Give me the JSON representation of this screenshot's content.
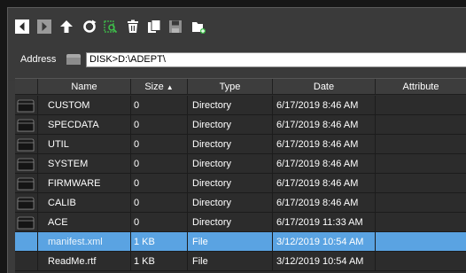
{
  "toolbar": {
    "buttons": [
      {
        "name": "back-icon"
      },
      {
        "name": "forward-icon"
      },
      {
        "name": "up-icon"
      },
      {
        "name": "refresh-icon"
      },
      {
        "name": "search-icon"
      },
      {
        "name": "delete-icon"
      },
      {
        "name": "copy-icon"
      },
      {
        "name": "save-icon"
      },
      {
        "name": "new-folder-icon"
      }
    ]
  },
  "address": {
    "label": "Address",
    "value": "DISK>D:\\ADEPT\\"
  },
  "table": {
    "columns": {
      "name": "Name",
      "size": "Size",
      "size_sort": "▲",
      "type": "Type",
      "date": "Date",
      "attribute": "Attribute"
    },
    "rows": [
      {
        "name": "CUSTOM",
        "size": "0",
        "type": "Directory",
        "date": "6/17/2019 8:46 AM",
        "attribute": ""
      },
      {
        "name": "SPECDATA",
        "size": "0",
        "type": "Directory",
        "date": "6/17/2019 8:46 AM",
        "attribute": ""
      },
      {
        "name": "UTIL",
        "size": "0",
        "type": "Directory",
        "date": "6/17/2019 8:46 AM",
        "attribute": ""
      },
      {
        "name": "SYSTEM",
        "size": "0",
        "type": "Directory",
        "date": "6/17/2019 8:46 AM",
        "attribute": ""
      },
      {
        "name": "FIRMWARE",
        "size": "0",
        "type": "Directory",
        "date": "6/17/2019 8:46 AM",
        "attribute": ""
      },
      {
        "name": "CALIB",
        "size": "0",
        "type": "Directory",
        "date": "6/17/2019 8:46 AM",
        "attribute": ""
      },
      {
        "name": "ACE",
        "size": "0",
        "type": "Directory",
        "date": "6/17/2019 11:33 AM",
        "attribute": ""
      },
      {
        "name": "manifest.xml",
        "size": "1 KB",
        "type": "File",
        "date": "3/12/2019 10:54 AM",
        "attribute": ""
      },
      {
        "name": "ReadMe.rtf",
        "size": "1 KB",
        "type": "File",
        "date": "3/12/2019 10:54 AM",
        "attribute": ""
      }
    ],
    "selected_row": "manifest.xml"
  },
  "colors": {
    "background": "#3b3b3b",
    "selection": "#5aa3e2",
    "accent_green": "#3ec24a"
  }
}
